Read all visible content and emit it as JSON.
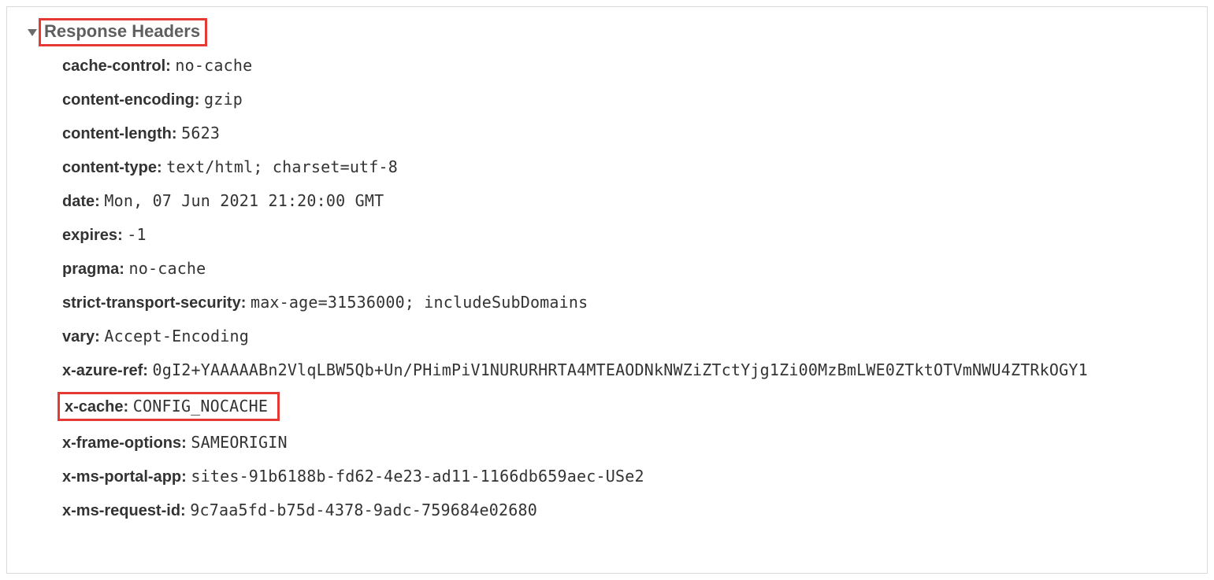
{
  "section": {
    "title": "Response Headers"
  },
  "highlight_index": 10,
  "headers": [
    {
      "name": "cache-control",
      "value": "no-cache"
    },
    {
      "name": "content-encoding",
      "value": "gzip"
    },
    {
      "name": "content-length",
      "value": "5623"
    },
    {
      "name": "content-type",
      "value": "text/html; charset=utf-8"
    },
    {
      "name": "date",
      "value": "Mon, 07 Jun 2021 21:20:00 GMT"
    },
    {
      "name": "expires",
      "value": "-1"
    },
    {
      "name": "pragma",
      "value": "no-cache"
    },
    {
      "name": "strict-transport-security",
      "value": "max-age=31536000; includeSubDomains"
    },
    {
      "name": "vary",
      "value": "Accept-Encoding"
    },
    {
      "name": "x-azure-ref",
      "value": "0gI2+YAAAAABn2VlqLBW5Qb+Un/PHimPiV1NURURHRTA4MTEAODNkNWZiZTctYjg1Zi00MzBmLWE0ZTktOTVmNWU4ZTRkOGY1"
    },
    {
      "name": "x-cache",
      "value": "CONFIG_NOCACHE"
    },
    {
      "name": "x-frame-options",
      "value": "SAMEORIGIN"
    },
    {
      "name": "x-ms-portal-app",
      "value": "sites-91b6188b-fd62-4e23-ad11-1166db659aec-USe2"
    },
    {
      "name": "x-ms-request-id",
      "value": "9c7aa5fd-b75d-4378-9adc-759684e02680"
    }
  ]
}
